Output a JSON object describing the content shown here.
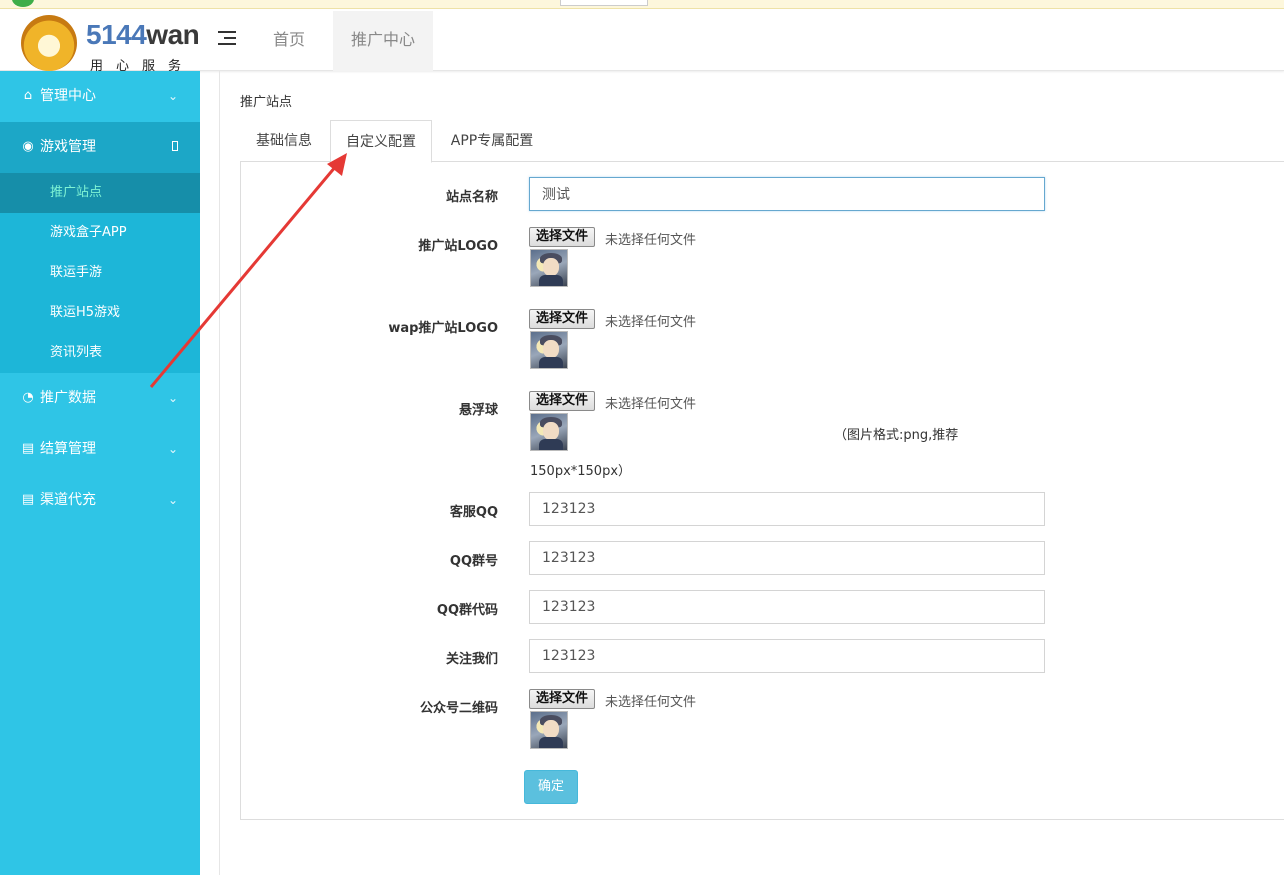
{
  "brand": {
    "number": "5144",
    "word": "wan",
    "slogan": "用心服务"
  },
  "header": {
    "tabs": [
      "首页",
      "推广中心"
    ]
  },
  "sidebar": {
    "items": [
      {
        "label": "管理中心",
        "icon": "home-icon"
      },
      {
        "label": "游戏管理",
        "icon": "gamepad-icon"
      },
      {
        "label": "推广数据",
        "icon": "pie-chart-icon"
      },
      {
        "label": "结算管理",
        "icon": "clipboard-icon"
      },
      {
        "label": "渠道代充",
        "icon": "clipboard-icon"
      }
    ],
    "submenu": [
      "推广站点",
      "游戏盒子APP",
      "联运手游",
      "联运H5游戏",
      "资讯列表"
    ]
  },
  "breadcrumb": "推广站点",
  "tabs": [
    "基础信息",
    "自定义配置",
    "APP专属配置"
  ],
  "form": {
    "site_name_label": "站点名称",
    "site_name_value": "测试",
    "logo_label": "推广站LOGO",
    "wap_logo_label": "wap推广站LOGO",
    "float_ball_label": "悬浮球",
    "service_qq_label": "客服QQ",
    "service_qq_value": "123123",
    "qq_group_label": "QQ群号",
    "qq_group_value": "123123",
    "qq_group_code_label": "QQ群代码",
    "qq_group_code_value": "123123",
    "follow_label": "关注我们",
    "follow_value": "123123",
    "qrcode_label": "公众号二维码",
    "file_button": "选择文件",
    "no_file": "未选择任何文件",
    "float_hint_1": "（图片格式:png,推荐",
    "float_hint_2": "150px*150px）",
    "submit": "确定"
  },
  "colors": {
    "sidebar": "#2fc5e6",
    "sidebar_active": "#1ca7c7",
    "submenu_current": "#168ea9",
    "submit": "#5bc0de",
    "arrow": "#e53935"
  }
}
